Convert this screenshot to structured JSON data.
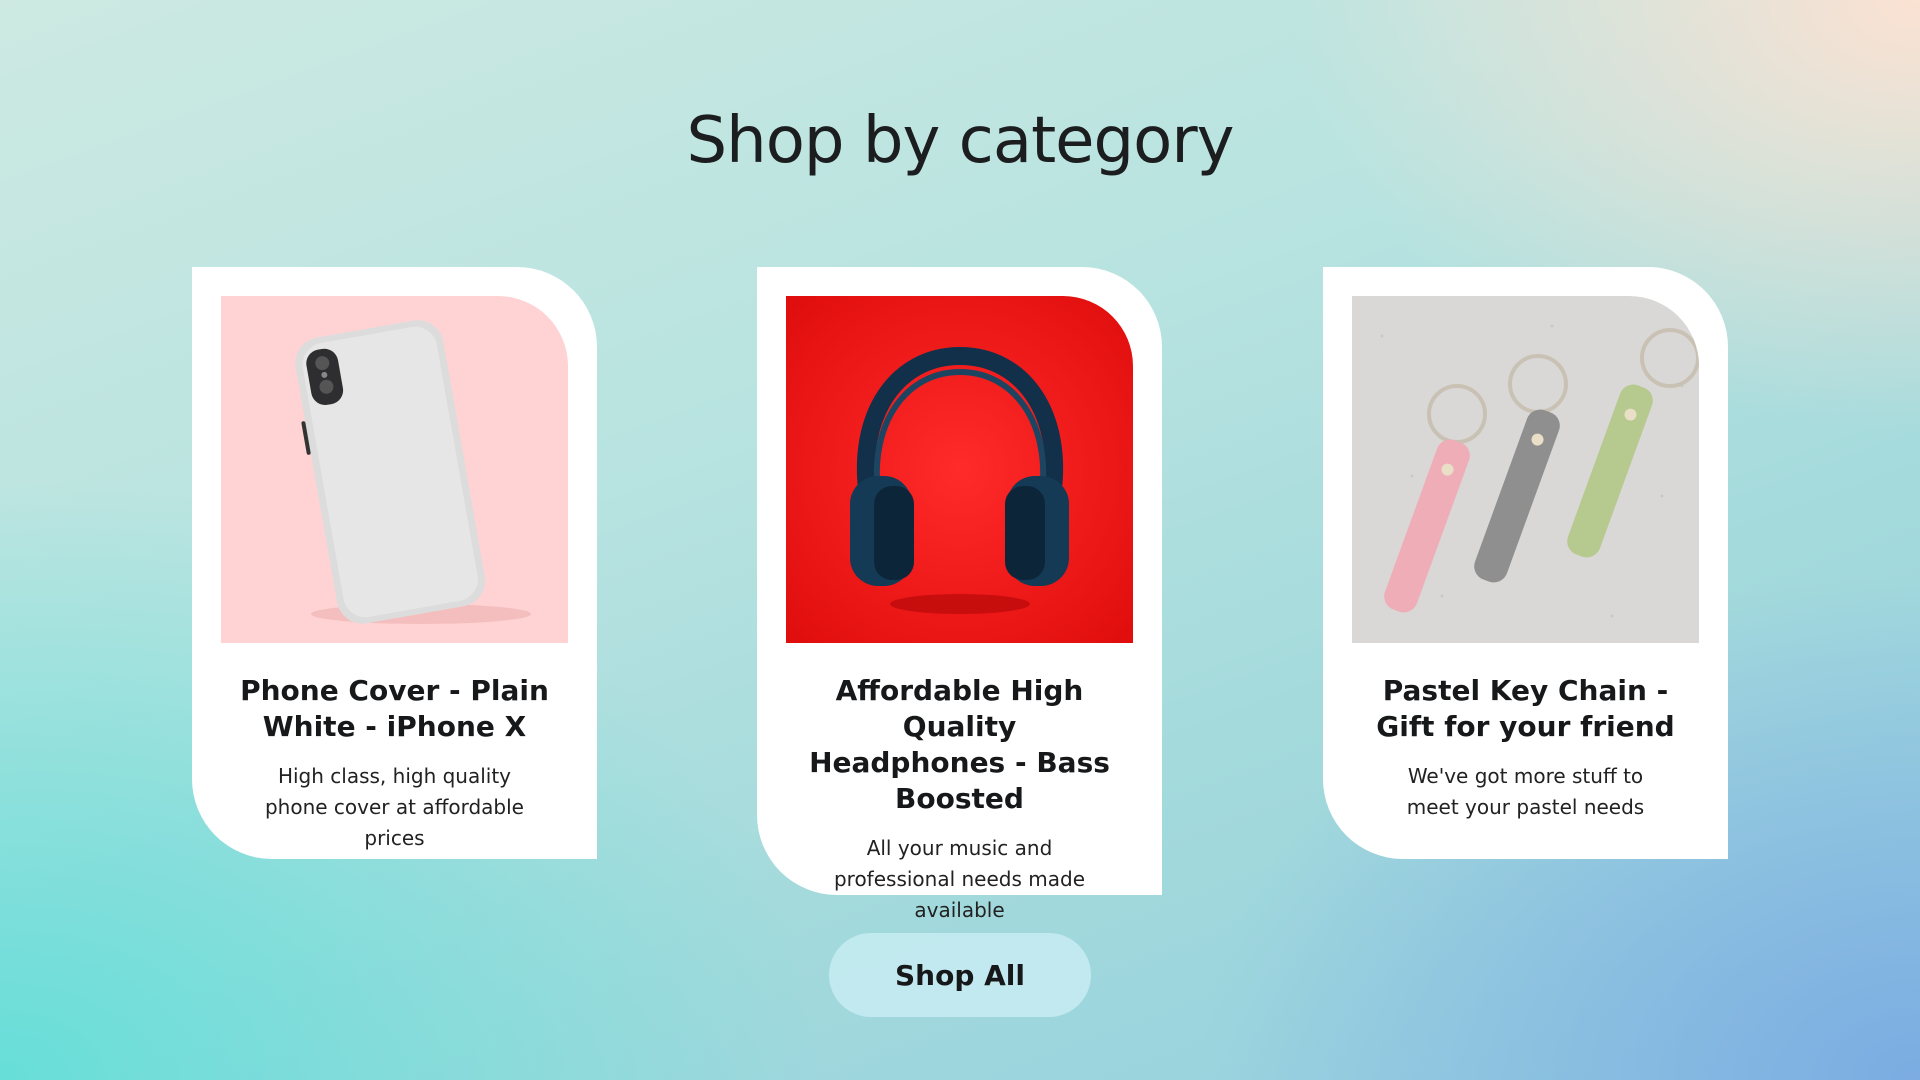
{
  "page": {
    "title": "Shop by category"
  },
  "cards": [
    {
      "title": "Phone Cover - Plain White - iPhone X",
      "description": "High class, high quality phone cover at affordable prices",
      "image_icon": "phone-cover-image",
      "image_bg": "#ffd3d3"
    },
    {
      "title": "Affordable High Quality Headphones - Bass Boosted",
      "description": "All your music and professional needs made available",
      "image_icon": "headphones-image",
      "image_bg": "#ee1818"
    },
    {
      "title": "Pastel Key Chain - Gift for your friend",
      "description": "We've got more stuff to meet your pastel needs",
      "image_icon": "keychains-image",
      "image_bg": "#dcdcdc"
    }
  ],
  "actions": {
    "shop_all_label": "Shop All"
  }
}
